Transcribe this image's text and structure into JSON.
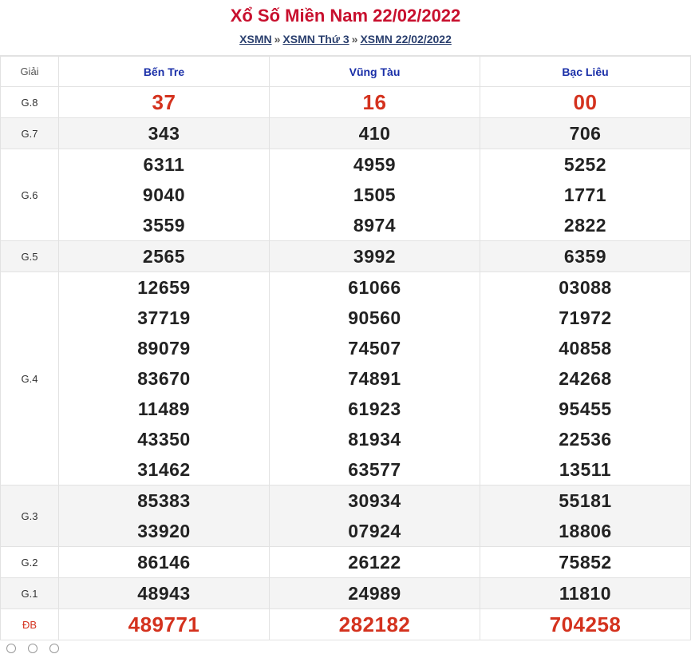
{
  "header": {
    "title": "Xổ Số Miền Nam 22/02/2022",
    "breadcrumb": [
      "XSMN",
      "XSMN Thứ 3",
      "XSMN 22/02/2022"
    ],
    "separator": "»"
  },
  "table": {
    "prize_header": "Giải",
    "provinces": [
      "Bến Tre",
      "Vũng Tàu",
      "Bạc Liêu"
    ],
    "rows": [
      {
        "label": "G.8",
        "values": [
          [
            "37"
          ],
          [
            "16"
          ],
          [
            "00"
          ]
        ]
      },
      {
        "label": "G.7",
        "values": [
          [
            "343"
          ],
          [
            "410"
          ],
          [
            "706"
          ]
        ]
      },
      {
        "label": "G.6",
        "values": [
          [
            "6311",
            "9040",
            "3559"
          ],
          [
            "4959",
            "1505",
            "8974"
          ],
          [
            "5252",
            "1771",
            "2822"
          ]
        ]
      },
      {
        "label": "G.5",
        "values": [
          [
            "2565"
          ],
          [
            "3992"
          ],
          [
            "6359"
          ]
        ]
      },
      {
        "label": "G.4",
        "values": [
          [
            "12659",
            "37719",
            "89079",
            "83670",
            "11489",
            "43350",
            "31462"
          ],
          [
            "61066",
            "90560",
            "74507",
            "74891",
            "61923",
            "81934",
            "63577"
          ],
          [
            "03088",
            "71972",
            "40858",
            "24268",
            "95455",
            "22536",
            "13511"
          ]
        ]
      },
      {
        "label": "G.3",
        "values": [
          [
            "85383",
            "33920"
          ],
          [
            "30934",
            "07924"
          ],
          [
            "55181",
            "18806"
          ]
        ]
      },
      {
        "label": "G.2",
        "values": [
          [
            "86146"
          ],
          [
            "26122"
          ],
          [
            "75852"
          ]
        ]
      },
      {
        "label": "G.1",
        "values": [
          [
            "48943"
          ],
          [
            "24989"
          ],
          [
            "11810"
          ]
        ]
      },
      {
        "label": "ĐB",
        "values": [
          [
            "489771"
          ],
          [
            "282182"
          ],
          [
            "704258"
          ]
        ]
      }
    ]
  }
}
